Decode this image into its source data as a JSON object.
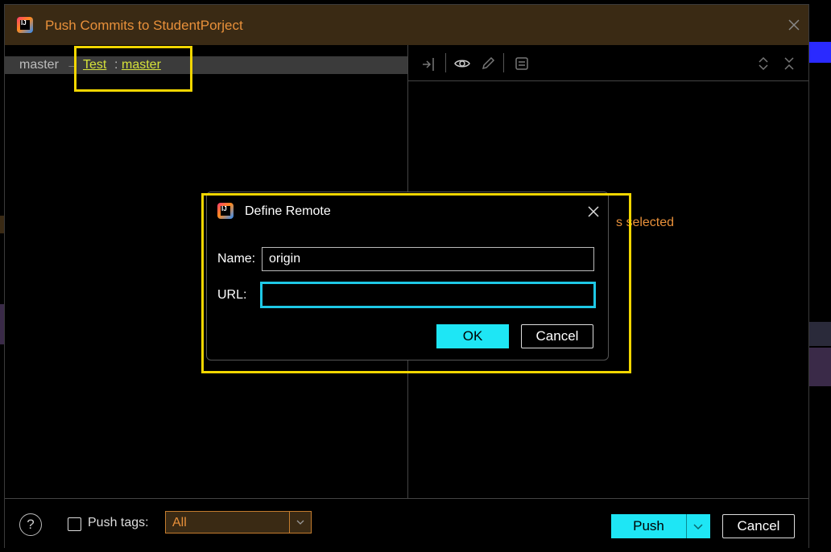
{
  "window": {
    "title": "Push Commits to StudentPorject",
    "logo_text": "IJ"
  },
  "branch": {
    "source": "master",
    "arrow": "→",
    "remote": "Test",
    "separator": ":",
    "target": "master"
  },
  "right_pane": {
    "message_fragment": "s selected"
  },
  "bottom": {
    "help": "?",
    "push_tags_label": "Push tags:",
    "tags_value": "All",
    "push_label": "Push",
    "cancel_label": "Cancel"
  },
  "define_remote": {
    "title": "Define Remote",
    "name_label": "Name:",
    "name_value": "origin",
    "url_label": "URL:",
    "url_value": "",
    "ok_label": "OK",
    "cancel_label": "Cancel"
  },
  "colors": {
    "accent": "#1ee6f5",
    "title_text": "#e8903a",
    "titlebar": "#3a2a14",
    "highlight": "#f2d600",
    "branch_link": "#d6e23a"
  }
}
